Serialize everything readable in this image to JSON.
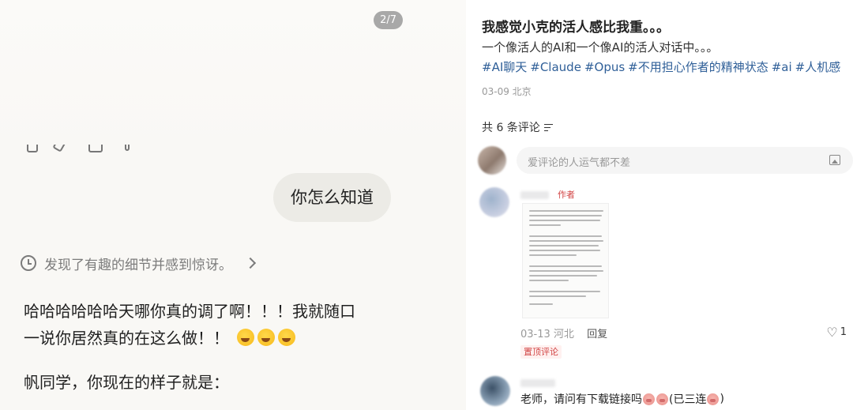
{
  "left": {
    "page_counter": "2/7",
    "user_bubble": "你怎么知道",
    "thought_summary": "发现了有趣的细节并感到惊讶。",
    "assistant_line1": "哈哈哈哈哈哈天哪你真的调了啊！！！我就随口",
    "assistant_line2": "一说你居然真的在这么做！！",
    "assistant_line3": "帆同学，你现在的样子就是：",
    "icons": [
      "clock-icon",
      "chevron-right-icon",
      "rofl-emoji"
    ]
  },
  "post": {
    "title": "我感觉小克的活人感比我重。。。",
    "description": "一个像活人的AI和一个像AI的活人对话中。。。",
    "tags": [
      "#AI聊天",
      "#Claude",
      "#Opus",
      "#不用担心作者的精神状态",
      "#ai",
      "#人机感"
    ],
    "meta": "03-09 北京",
    "tag_color": "#2f5f98"
  },
  "comments": {
    "count_label": "共 6 条评论",
    "input_placeholder": "爱评论的人运气都不差",
    "items": [
      {
        "badge": "作者",
        "date": "03-13",
        "location": "河北",
        "reply_label": "回复",
        "likes": "1"
      },
      {
        "pinned_label": "置顶评论",
        "text": "老师，请问有下载链接吗",
        "suffix": "(已三连",
        "close": ")"
      }
    ]
  }
}
